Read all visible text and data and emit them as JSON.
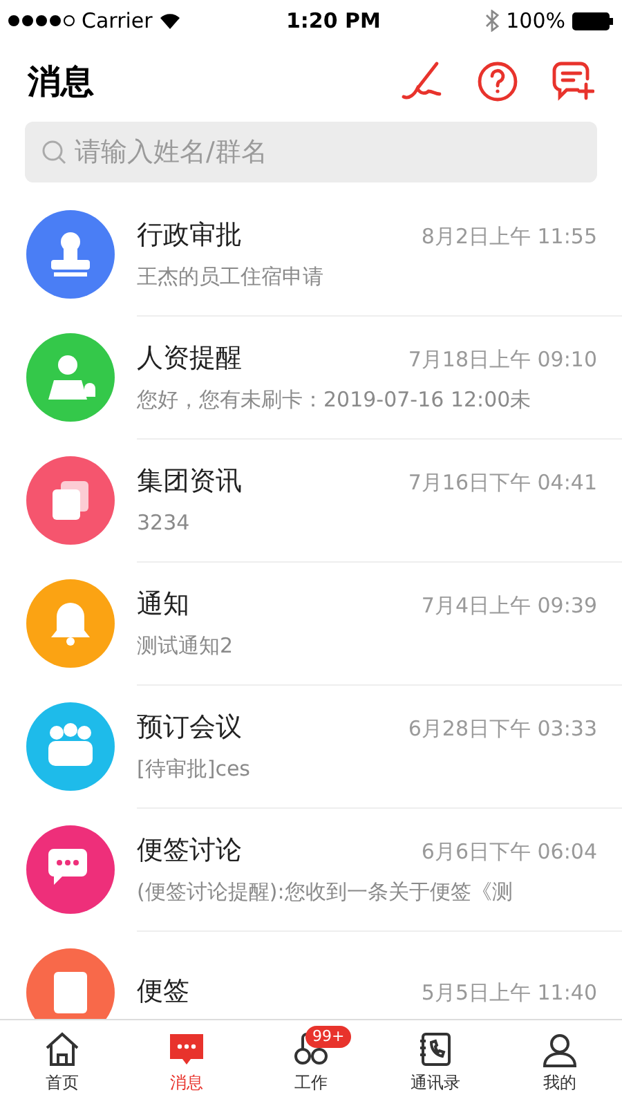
{
  "status_bar": {
    "carrier": "Carrier",
    "time": "1:20 PM",
    "battery": "100%"
  },
  "header": {
    "title": "消息"
  },
  "search": {
    "placeholder": "请输入姓名/群名"
  },
  "conversations": [
    {
      "kind": "stamp",
      "color": "#4a7ef5",
      "name": "行政审批",
      "time": "8月2日上午 11:55",
      "preview": "王杰的员工住宿申请"
    },
    {
      "kind": "person",
      "color": "#34c84a",
      "name": "人资提醒",
      "time": "7月18日上午 09:10",
      "preview": "您好，您有未刷卡：2019-07-16  12:00未"
    },
    {
      "kind": "docs",
      "color": "#f5556e",
      "name": "集团资讯",
      "time": "7月16日下午 04:41",
      "preview": "3234"
    },
    {
      "kind": "bell",
      "color": "#fba313",
      "name": "通知",
      "time": "7月4日上午 09:39",
      "preview": "测试通知2"
    },
    {
      "kind": "group",
      "color": "#1ebbea",
      "name": "预订会议",
      "time": "6月28日下午 03:33",
      "preview": "[待审批]ces"
    },
    {
      "kind": "chat",
      "color": "#ee2f7a",
      "name": "便签讨论",
      "time": "6月6日下午 06:04",
      "preview": "(便签讨论提醒):您收到一条关于便签《测"
    },
    {
      "kind": "note",
      "color": "#f8694a",
      "name": "便签",
      "time": "5月5日上午 11:40"
    }
  ],
  "tab_bar": [
    {
      "kind": "home",
      "label": "首页",
      "selected": false
    },
    {
      "kind": "message",
      "label": "消息",
      "selected": true
    },
    {
      "kind": "work",
      "label": "工作",
      "selected": false,
      "badge": "99+"
    },
    {
      "kind": "contacts",
      "label": "通讯录",
      "selected": false
    },
    {
      "kind": "me",
      "label": "我的",
      "selected": false
    }
  ]
}
